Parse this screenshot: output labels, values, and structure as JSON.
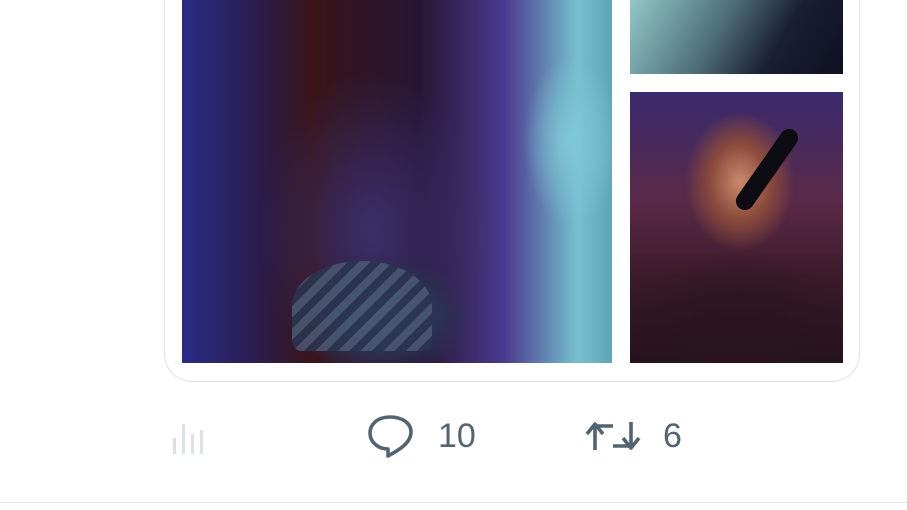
{
  "tweet": {
    "media": {
      "images": [
        {
          "alt": ""
        },
        {
          "alt": ""
        },
        {
          "alt": ""
        }
      ]
    },
    "actions": {
      "views": {
        "icon": "analytics-bar-chart-icon",
        "count": ""
      },
      "replies": {
        "icon": "reply-bubble-icon",
        "count": "10"
      },
      "retweets": {
        "icon": "retweet-icon",
        "count": "6"
      }
    }
  },
  "colors": {
    "icon_gray": "#536471",
    "faint_icon": "#cfd9de",
    "border": "#dfe3e7",
    "background": "#ffffff"
  }
}
